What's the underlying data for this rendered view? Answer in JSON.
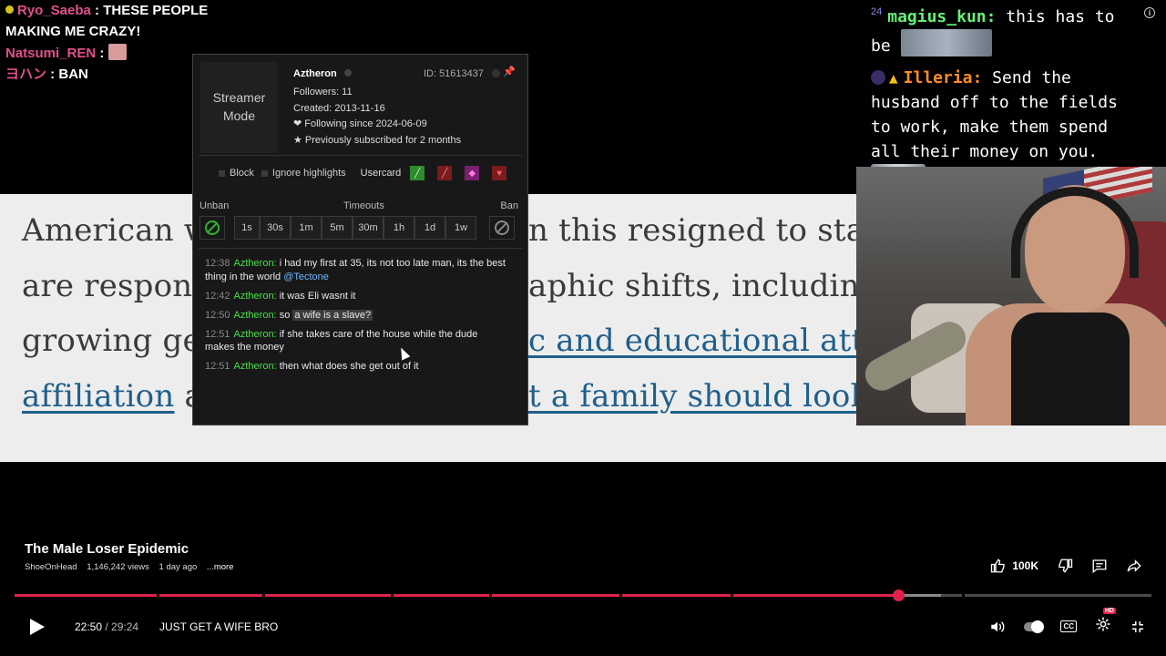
{
  "article": {
    "line1_left": "American w",
    "line1_right": "n this resigned to stay",
    "line2_left": "are respond",
    "line2_right": "aphic shifts, including",
    "line3_left": "growing ge",
    "line3_right": "c and educational atta",
    "line4_left_link": "affiliation",
    "line4_left_rest": " a",
    "line4_right_link": "t a family should look"
  },
  "chat_left": [
    {
      "name": "Ryo_Saeba",
      "name_color": "#e0508c",
      "text": "THESE PEOPLE",
      "cont": "MAKING ME CRAZY!"
    },
    {
      "name": "Natsumi_REN",
      "name_color": "#e0508c",
      "text": ""
    },
    {
      "name": "ヨハン",
      "name_color": "#e0508c",
      "text": "BAN"
    }
  ],
  "usercard": {
    "streamer_mode": "Streamer Mode",
    "username": "Aztheron",
    "id": "ID: 51613437",
    "followers": "Followers: 11",
    "created": "Created: 2013-11-16",
    "following": "❤ Following since 2024-06-09",
    "subscribed": "★ Previously subscribed for 2 months",
    "block": "Block",
    "ignore_highlights": "Ignore highlights",
    "usercard_label": "Usercard",
    "unban": "Unban",
    "timeouts": "Timeouts",
    "ban": "Ban",
    "timeout_options": [
      "1s",
      "30s",
      "1m",
      "5m",
      "30m",
      "1h",
      "1d",
      "1w"
    ],
    "messages": [
      {
        "ts": "12:38",
        "name": "Aztheron:",
        "text": "i had my first at 35, its not too late man, its the best thing in the world ",
        "mention": "@Tectone"
      },
      {
        "ts": "12:42",
        "name": "Aztheron:",
        "text": "it was Eli wasnt it"
      },
      {
        "ts": "12:50",
        "name": "Aztheron:",
        "pre": "so ",
        "highlight": "a wife is a slave?"
      },
      {
        "ts": "12:51",
        "name": "Aztheron:",
        "text": "if she takes care of the house while the dude makes the money"
      },
      {
        "ts": "12:51",
        "name": "Aztheron:",
        "text": "then what does she get out of it"
      }
    ]
  },
  "chat_right": {
    "msg1_badge": "24",
    "msg1_name": "magius_kun:",
    "msg1_text": " this has to be",
    "msg2_name": "Illeria:",
    "msg2_text": " Send the husband off to the fields to work, make them spend all their money on you."
  },
  "video": {
    "title": "The Male Loser Epidemic",
    "channel": "ShoeOnHead",
    "views": "1,146,242 views",
    "age": "1 day ago",
    "more": "...more",
    "likes": "100K",
    "time_current": "22:50",
    "time_sep": " / ",
    "time_total": "29:24",
    "chapter": "JUST GET A WIFE BRO",
    "played_fraction": 0.777,
    "buffered_fraction": 0.815,
    "hd_badge": "HD"
  },
  "colors": {
    "accent_red": "#e0224a",
    "chat_green": "#4ae04a",
    "mention_blue": "#6fb7ff"
  }
}
